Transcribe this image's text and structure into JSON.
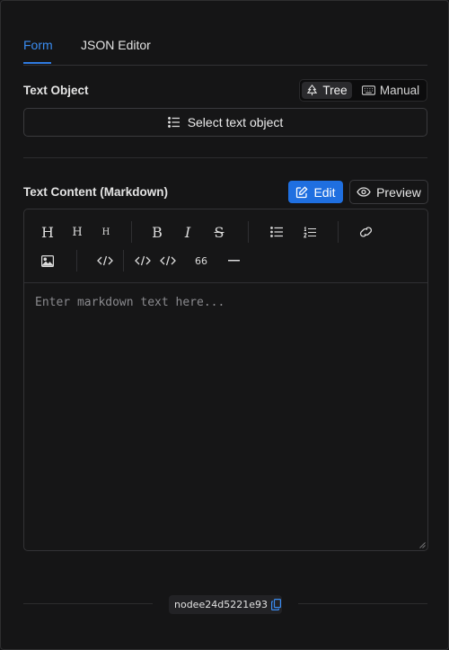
{
  "tabs": [
    {
      "label": "Form",
      "active": true
    },
    {
      "label": "JSON Editor",
      "active": false
    }
  ],
  "text_object": {
    "label": "Text Object",
    "modes": [
      {
        "label": "Tree",
        "icon": "tree-icon",
        "active": true
      },
      {
        "label": "Manual",
        "icon": "keyboard-icon",
        "active": false
      }
    ],
    "select_label": "Select text object"
  },
  "text_content": {
    "label": "Text Content (Markdown)",
    "edit_label": "Edit",
    "preview_label": "Preview",
    "placeholder": "Enter markdown text here...",
    "toolbar": {
      "h1": "H",
      "h2": "H",
      "h3": "H",
      "bold": "B",
      "italic": "I",
      "strike": "S",
      "quote": "66"
    }
  },
  "footer": {
    "node_id": "nodee24d5221e93"
  },
  "colors": {
    "accent": "#1f6fe0",
    "tab_active": "#3a8cf0",
    "background": "#151516"
  }
}
